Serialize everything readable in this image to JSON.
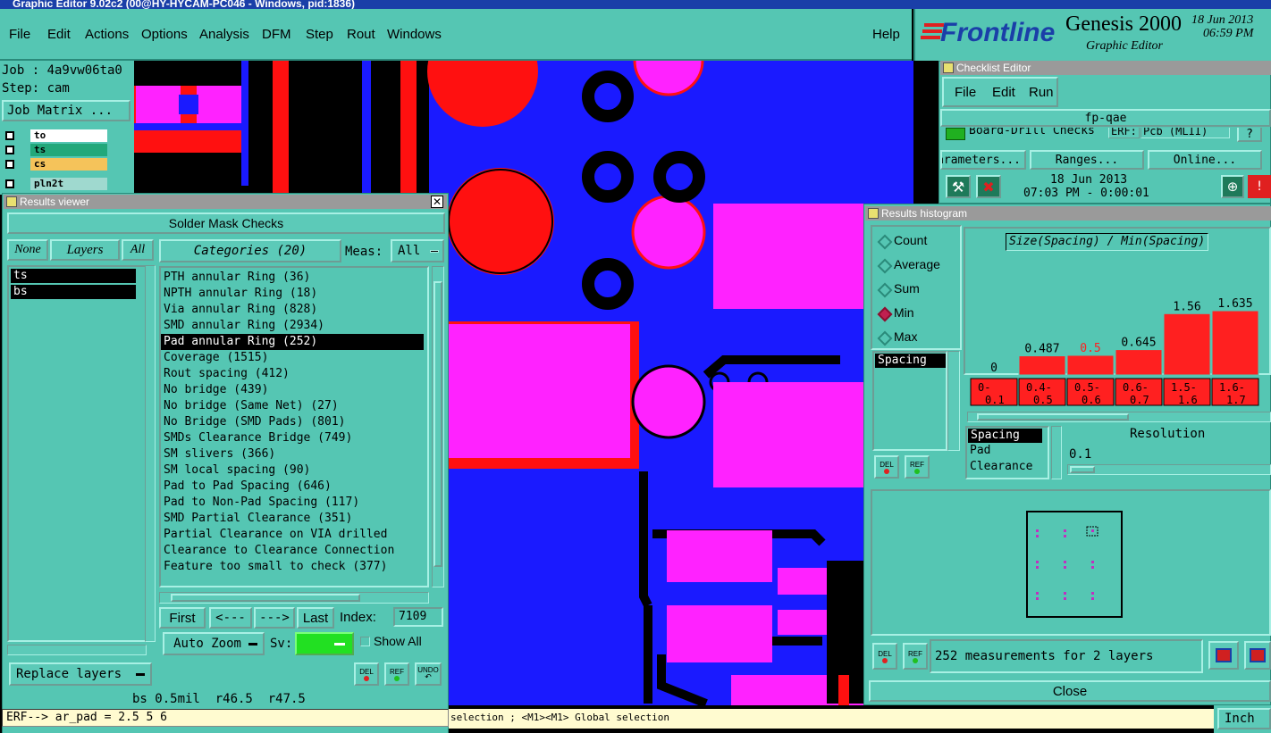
{
  "window_title": "Graphic Editor 9.02c2 (00@HY-HYCAM-PC046 - Windows, pid:1836)",
  "menu": {
    "file": "File",
    "edit": "Edit",
    "actions": "Actions",
    "options": "Options",
    "analysis": "Analysis",
    "dfm": "DFM",
    "step": "Step",
    "rout": "Rout",
    "windows": "Windows",
    "help": "Help"
  },
  "brand": {
    "logo": "Frontline",
    "product": "Genesis 2000",
    "subtitle": "Graphic Editor",
    "date": "18 Jun 2013",
    "time": "06:59 PM"
  },
  "job": {
    "job_label": "Job : 4a9vw06ta0",
    "step_label": "Step: cam",
    "matrix_button": "Job Matrix ..."
  },
  "layers": [
    {
      "name": "to",
      "color": "#ffffff"
    },
    {
      "name": "ts",
      "color": "#22a87a"
    },
    {
      "name": "cs",
      "color": "#f5c35a"
    },
    {
      "name": "pln2t",
      "color": "#9fd9cf"
    }
  ],
  "results_viewer": {
    "title": "Results viewer",
    "header": "Solder Mask Checks",
    "none_btn": "None",
    "layers_btn": "Layers",
    "all_btn": "All",
    "categories_btn": "Categories (20)",
    "meas_label": "Meas:",
    "meas_value": "All",
    "layer_list": [
      "ts",
      "bs"
    ],
    "categories": [
      "PTH annular Ring (36)",
      "NPTH annular Ring (18)",
      "Via annular Ring (828)",
      "SMD annular Ring (2934)",
      "Pad annular Ring (252)",
      "Coverage (1515)",
      "Rout spacing (412)",
      "No bridge (439)",
      "No bridge (Same Net) (27)",
      "No Bridge (SMD Pads) (801)",
      "SMDs Clearance Bridge (749)",
      "SM slivers (366)",
      "SM local spacing (90)",
      "Pad to Pad Spacing (646)",
      "Pad to Non-Pad Spacing (117)",
      "SMD Partial Clearance (351)",
      "Partial Clearance on VIA drilled",
      "Clearance to Clearance Connection",
      "Feature too small to check (377)"
    ],
    "selected_category": "Pad annular Ring (252)",
    "first": "First",
    "prev": "<---",
    "next": "--->",
    "last": "Last",
    "index_label": "Index:",
    "index_value": "7109",
    "auto_zoom": "Auto Zoom",
    "sv_label": "Sv:",
    "show_all": "Show All",
    "replace_layers": "Replace layers",
    "del": "DEL",
    "ref": "REF",
    "undo": "UNDO",
    "status": "bs 0.5mil  r46.5  r47.5"
  },
  "command_line": "ERF--> ar_pad = 2.5 5 6",
  "status_bar": "selection ; <M1><M1> Global selection",
  "units": "Inch",
  "checklist": {
    "title": "Checklist Editor",
    "menu": {
      "file": "File",
      "edit": "Edit",
      "run": "Run"
    },
    "name": "fp-qae",
    "row": "Board-Drill Checks",
    "erf_label": "ERF:",
    "erf_value": "Pcb (MLII)",
    "help": "?",
    "parameters": "Parameters...",
    "ranges": "Ranges...",
    "online": "Online...",
    "run_date": "18 Jun 2013",
    "run_time": "07:03 PM - 0:00:01"
  },
  "histogram": {
    "title": "Results histogram",
    "modes": [
      "Count",
      "Average",
      "Sum",
      "Min",
      "Max"
    ],
    "selected_mode": "Min",
    "measure": "Spacing",
    "formula": "Size(Spacing) / Min(Spacing)",
    "bar_values": [
      "0",
      "0.487",
      "0.5",
      "0.645",
      "1.56",
      "1.635"
    ],
    "bin_labels": [
      {
        "top": "0-",
        "bottom": "0.1"
      },
      {
        "top": "0.4-",
        "bottom": "0.5"
      },
      {
        "top": "0.5-",
        "bottom": "0.6"
      },
      {
        "top": "0.6-",
        "bottom": "0.7"
      },
      {
        "top": "1.5-",
        "bottom": "1.6"
      },
      {
        "top": "1.6-",
        "bottom": "1.7"
      }
    ],
    "measure_list": [
      "Spacing",
      "Pad",
      "Clearance"
    ],
    "resolution_label": "Resolution",
    "resolution_value": "0.1",
    "summary": "252 measurements for 2 layers",
    "close": "Close",
    "del": "DEL",
    "ref": "REF"
  },
  "chart_data": {
    "type": "bar",
    "title": "Size(Spacing) / Min(Spacing)",
    "categories": [
      "0-0.1",
      "0.4-0.5",
      "0.5-0.6",
      "0.6-0.7",
      "1.5-1.6",
      "1.6-1.7"
    ],
    "values": [
      0,
      0.487,
      0.5,
      0.645,
      1.56,
      1.635
    ],
    "highlight_color": "#ff2020",
    "bar_color": "#ff2020"
  }
}
